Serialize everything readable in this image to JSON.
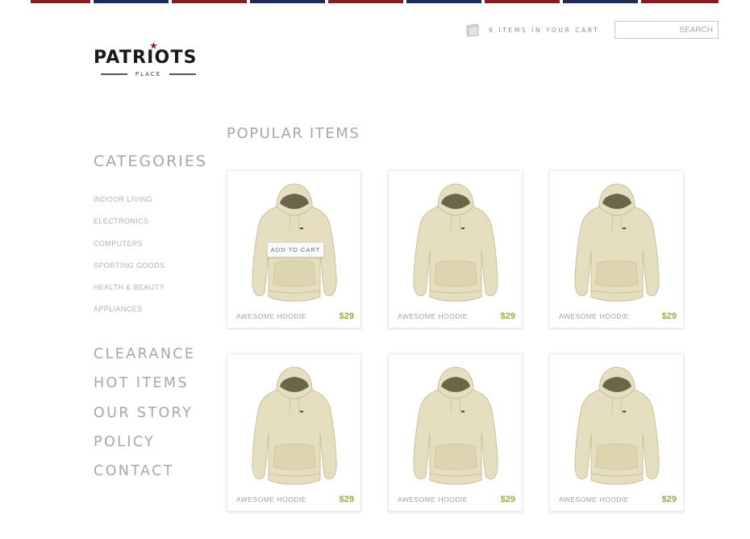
{
  "header": {
    "cart_text": "9 ITEMS IN YOUR CART",
    "search_placeholder": "SEARCH"
  },
  "logo": {
    "word": "PATRIOTS",
    "sub": "PLACE"
  },
  "sidebar": {
    "categories_heading": "CATEGORIES",
    "categories": [
      "INDOOR LIVING",
      "ELECTRONICS",
      "COMPUTERS",
      "SPORTING GOODS",
      "HEALTH & BEAUTY",
      "APPLIANCES"
    ],
    "nav": [
      "CLEARANCE",
      "HOT ITEMS",
      "OUR STORY",
      "POLICY",
      "CONTACT"
    ]
  },
  "main": {
    "title": "POPULAR ITEMS",
    "add_to_cart_label": "ADD TO CART",
    "products": [
      {
        "name": "AWESOME HOODIE",
        "price": "$29"
      },
      {
        "name": "AWESOME HOODIE",
        "price": "$29"
      },
      {
        "name": "AWESOME HOODIE",
        "price": "$29"
      },
      {
        "name": "AWESOME HOODIE",
        "price": "$29"
      },
      {
        "name": "AWESOME HOODIE",
        "price": "$29"
      },
      {
        "name": "AWESOME HOODIE",
        "price": "$29"
      }
    ]
  },
  "colors": {
    "stripe_red": "#8b1a22",
    "stripe_navy": "#1f2a5a",
    "price_green": "#8db43a",
    "hoodie": "#e6dfbf"
  }
}
